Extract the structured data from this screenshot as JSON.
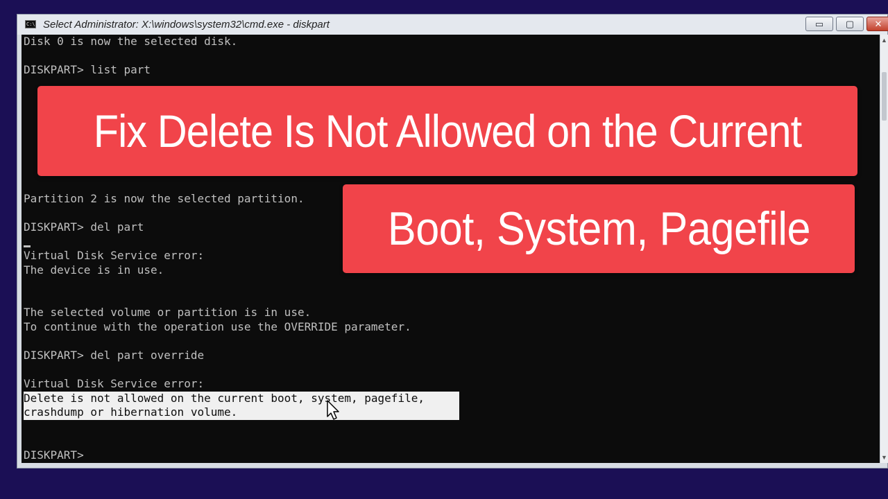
{
  "window": {
    "title": "Select Administrator: X:\\windows\\system32\\cmd.exe - diskpart",
    "controls": {
      "minimize": "▭",
      "maximize": "▢",
      "close": "✕"
    }
  },
  "console": {
    "lines": [
      "Disk 0 is now the selected disk.",
      "",
      "DISKPART> list part",
      "",
      "",
      "",
      "",
      "",
      "",
      "",
      "",
      "Partition 2 is now the selected partition.",
      "",
      "DISKPART> del part",
      "",
      "Virtual Disk Service error:",
      "The device is in use.",
      "",
      "",
      "The selected volume or partition is in use.",
      "To continue with the operation use the OVERRIDE parameter.",
      "",
      "DISKPART> del part override",
      "",
      "Virtual Disk Service error:",
      "Delete is not allowed on the current boot, system, pagefile,",
      "crashdump or hibernation volume.",
      "",
      "",
      "DISKPART>"
    ],
    "selected_line_indices": [
      25,
      26
    ]
  },
  "overlay": {
    "line1": "Fix Delete Is Not Allowed on the Current",
    "line2": "Boot, System, Pagefile",
    "color": "#f1444a"
  }
}
